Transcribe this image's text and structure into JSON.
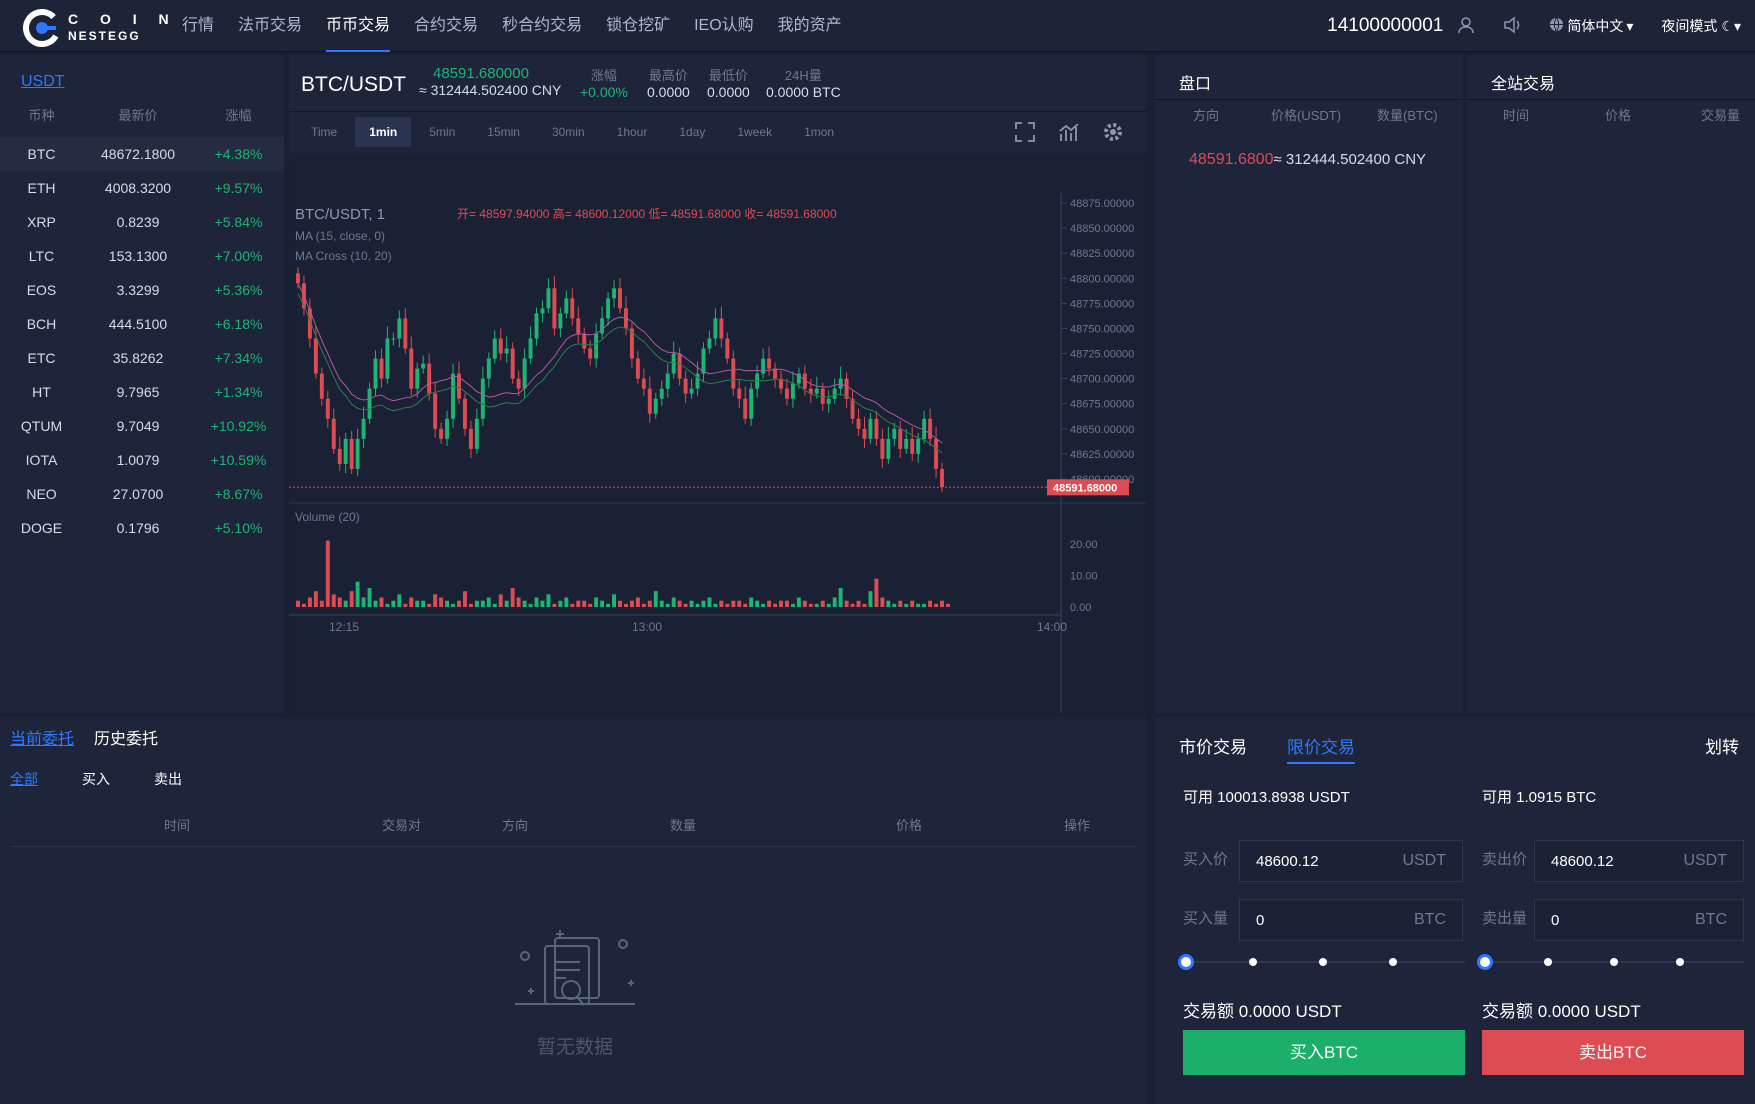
{
  "logo": {
    "line1": "C O I N",
    "line2": "NESTEGG"
  },
  "nav": [
    "行情",
    "法币交易",
    "币币交易",
    "合约交易",
    "秒合约交易",
    "锁仓挖矿",
    "IEO认购",
    "我的资产"
  ],
  "user": {
    "phone": "14100000001",
    "lang": "简体中文",
    "night": "夜间模式"
  },
  "market": {
    "quote_tab": "USDT",
    "headers": [
      "币种",
      "最新价",
      "涨幅"
    ],
    "rows": [
      {
        "coin": "BTC",
        "price": "48672.1800",
        "change": "+4.38%"
      },
      {
        "coin": "ETH",
        "price": "4008.3200",
        "change": "+9.57%"
      },
      {
        "coin": "XRP",
        "price": "0.8239",
        "change": "+5.84%"
      },
      {
        "coin": "LTC",
        "price": "153.1300",
        "change": "+7.00%"
      },
      {
        "coin": "EOS",
        "price": "3.3299",
        "change": "+5.36%"
      },
      {
        "coin": "BCH",
        "price": "444.5100",
        "change": "+6.18%"
      },
      {
        "coin": "ETC",
        "price": "35.8262",
        "change": "+7.34%"
      },
      {
        "coin": "HT",
        "price": "9.7965",
        "change": "+1.34%"
      },
      {
        "coin": "QTUM",
        "price": "9.7049",
        "change": "+10.92%"
      },
      {
        "coin": "IOTA",
        "price": "1.0079",
        "change": "+10.59%"
      },
      {
        "coin": "NEO",
        "price": "27.0700",
        "change": "+8.67%"
      },
      {
        "coin": "DOGE",
        "price": "0.1796",
        "change": "+5.10%"
      }
    ]
  },
  "ticker": {
    "pair": "BTC/USDT",
    "price": "48591.680000",
    "cny": "≈ 312444.502400 CNY",
    "change_label": "涨幅",
    "change": "+0.00%",
    "high_label": "最高价",
    "high": "0.0000",
    "low_label": "最低价",
    "low": "0.0000",
    "vol_label": "24H量",
    "vol": "0.0000 BTC"
  },
  "timeframes": [
    "Time",
    "1min",
    "5min",
    "15min",
    "30min",
    "1hour",
    "1day",
    "1week",
    "1mon"
  ],
  "chart_data": {
    "type": "candlestick",
    "legend": "BTC/USDT, 1",
    "ohlc_text": "开= 48597.94000  高= 48600.12000  低= 48591.68000  收= 48591.68000",
    "indicators": [
      "MA (15, close, 0)",
      "MA Cross (10, 20)"
    ],
    "y_ticks": [
      "48875.00000",
      "48850.00000",
      "48825.00000",
      "48800.00000",
      "48775.00000",
      "48750.00000",
      "48725.00000",
      "48700.00000",
      "48675.00000",
      "48650.00000",
      "48625.00000",
      "48600.00000"
    ],
    "ylim": [
      48588,
      48885
    ],
    "last_price": "48591.68000",
    "x_ticks": [
      "12:15",
      "13:00",
      "14:00"
    ],
    "volume_label": "Volume (20)",
    "volume_ticks": [
      "20.00",
      "10.00",
      "0.00"
    ],
    "closes": [
      48795,
      48770,
      48740,
      48705,
      48680,
      48660,
      48630,
      48615,
      48640,
      48610,
      48640,
      48660,
      48690,
      48720,
      48700,
      48740,
      48740,
      48760,
      48730,
      48690,
      48710,
      48715,
      48685,
      48650,
      48640,
      48660,
      48705,
      48680,
      48650,
      48630,
      48660,
      48700,
      48720,
      48740,
      48725,
      48730,
      48700,
      48690,
      48720,
      48740,
      48765,
      48770,
      48790,
      48750,
      48765,
      48780,
      48760,
      48745,
      48730,
      48720,
      48745,
      48760,
      48780,
      48790,
      48770,
      48750,
      48720,
      48700,
      48690,
      48665,
      48680,
      48690,
      48705,
      48725,
      48700,
      48685,
      48690,
      48705,
      48730,
      48740,
      48760,
      48740,
      48720,
      48690,
      48680,
      48660,
      48690,
      48705,
      48720,
      48710,
      48700,
      48690,
      48680,
      48695,
      48705,
      48690,
      48685,
      48690,
      48675,
      48680,
      48690,
      48700,
      48680,
      48660,
      48650,
      48640,
      48660,
      48640,
      48620,
      48640,
      48650,
      48630,
      48640,
      48625,
      48640,
      48660,
      48640,
      48610,
      48592
    ],
    "volumes": [
      2,
      1,
      3,
      5,
      2,
      21,
      4,
      3,
      2,
      5,
      8,
      3,
      6,
      2,
      3,
      1,
      2,
      4,
      1,
      3,
      2,
      2,
      1,
      4,
      3,
      2,
      1,
      2,
      5,
      1,
      2,
      2,
      3,
      1,
      4,
      2,
      6,
      3,
      2,
      1,
      3,
      2,
      4,
      1,
      2,
      3,
      1,
      2,
      2,
      1,
      3,
      2,
      1,
      4,
      2,
      1,
      2,
      3,
      1,
      2,
      5,
      2,
      1,
      3,
      2,
      1,
      2,
      1,
      2,
      3,
      1,
      2,
      1,
      2,
      2,
      1,
      3,
      2,
      1,
      2,
      1,
      2,
      2,
      1,
      3,
      2,
      1,
      1,
      2,
      1,
      3,
      6,
      2,
      1,
      2,
      1,
      5,
      9,
      3,
      2,
      1,
      2,
      1,
      2,
      1,
      1,
      2,
      1,
      2,
      1
    ]
  },
  "orders": {
    "tabs": [
      "当前委托",
      "历史委托"
    ],
    "subtabs": [
      "全部",
      "买入",
      "卖出"
    ],
    "headers": [
      "时间",
      "交易对",
      "方向",
      "数量",
      "价格",
      "操作"
    ],
    "empty": "暂无数据"
  },
  "book": {
    "title": "盘口",
    "headers": [
      "方向",
      "价格(USDT)",
      "数量(BTC)"
    ],
    "price": "48591.6800",
    "cny": "≈ 312444.502400 CNY"
  },
  "trades": {
    "title": "全站交易",
    "headers": [
      "时间",
      "价格",
      "交易量"
    ]
  },
  "trade": {
    "tabs": [
      "市价交易",
      "限价交易"
    ],
    "transfer": "划转",
    "buy": {
      "avail": "可用 100013.8938 USDT",
      "price_label": "买入价",
      "price": "48600.12",
      "price_unit": "USDT",
      "qty_label": "买入量",
      "qty": "0",
      "qty_unit": "BTC",
      "amount": "交易额 0.0000 USDT",
      "button": "买入BTC"
    },
    "sell": {
      "avail": "可用 1.0915 BTC",
      "price_label": "卖出价",
      "price": "48600.12",
      "price_unit": "USDT",
      "qty_label": "卖出量",
      "qty": "0",
      "qty_unit": "BTC",
      "amount": "交易额 0.0000 USDT",
      "button": "卖出BTC"
    }
  },
  "colors": {
    "up": "#1db474",
    "down": "#dd4b53",
    "accent": "#2e78ff",
    "bg": "#1a2034",
    "panel": "#1e253a"
  }
}
